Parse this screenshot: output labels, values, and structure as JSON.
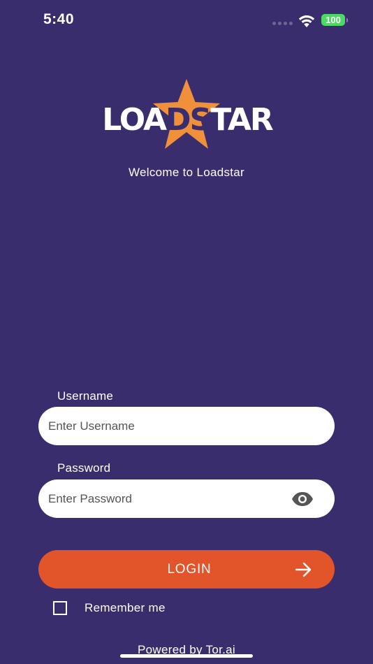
{
  "status_bar": {
    "time": "5:40",
    "battery": "100"
  },
  "brand": {
    "logo_part1": "LOA",
    "logo_part2": "DS",
    "logo_part3": "TAR",
    "welcome": "Welcome to Loadstar",
    "colors": {
      "background": "#3a2d6e",
      "accent": "#e2542a",
      "star": "#f0903a"
    }
  },
  "form": {
    "username_label": "Username",
    "username_placeholder": "Enter Username",
    "username_value": "",
    "password_label": "Password",
    "password_placeholder": "Enter Password",
    "password_value": "",
    "password_toggle_icon": "eye-icon",
    "login_label": "LOGIN",
    "login_icon": "arrow-right-icon",
    "remember_label": "Remember me",
    "remember_checked": false
  },
  "footer": {
    "powered_by": "Powered by Tor.ai"
  }
}
